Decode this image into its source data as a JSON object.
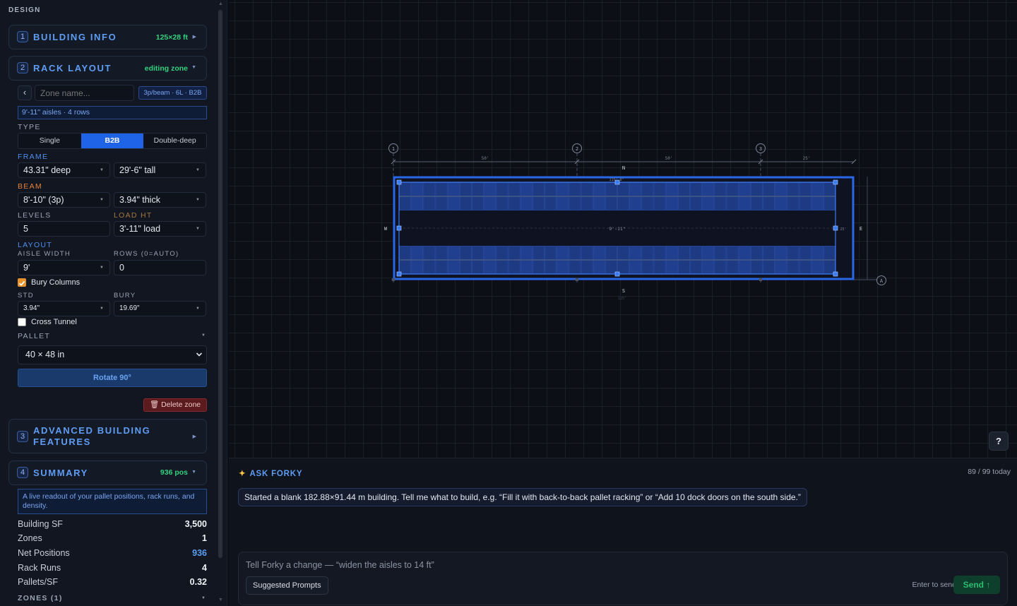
{
  "sidebar": {
    "header": "DESIGN",
    "sections": [
      {
        "num": "1",
        "title": "BUILDING INFO",
        "meta": "125×28 ft"
      },
      {
        "num": "2",
        "title": "RACK LAYOUT",
        "meta": "editing zone"
      },
      {
        "num": "3",
        "title_line1": "ADVANCED BUILDING",
        "title_line2": "FEATURES"
      },
      {
        "num": "4",
        "title": "SUMMARY",
        "meta": "936 pos"
      }
    ],
    "rack": {
      "back": "‹",
      "zone_placeholder": "Zone name...",
      "config_badge": "3p/beam · 6L · B2B",
      "aisle_info": "9'-11\" aisles · 4 rows",
      "type_label": "TYPE",
      "type_options": [
        "Single",
        "B2B",
        "Double-deep"
      ],
      "frame_label": "FRAME",
      "frame_depth": "43.31\" deep",
      "frame_height": "29'-6\" tall",
      "beam_label": "BEAM",
      "beam_length": "8'-10\" (3p)",
      "beam_thick": "3.94\" thick",
      "levels_label": "LEVELS",
      "levels_value": "5",
      "load_ht_label": "LOAD HT",
      "load_ht_value": "3'-11\" load",
      "layout_label": "LAYOUT",
      "aisle_width_label": "AISLE WIDTH",
      "aisle_width_value": "9'",
      "rows_label": "ROWS (0=AUTO)",
      "rows_value": "0",
      "bury_columns": "Bury Columns",
      "std_label": "STD",
      "std_value": "3.94\"",
      "bury_label": "BURY",
      "bury_value": "19.69\"",
      "cross_tunnel": "Cross Tunnel",
      "pallet_label": "PALLET",
      "pallet_value": "40 × 48 in",
      "rotate": "Rotate 90°",
      "delete": "🗑 Delete zone"
    },
    "summary": {
      "blurb": "A live readout of your pallet positions, rack runs, and density.",
      "rows": [
        {
          "label": "Building SF",
          "value": "3,500"
        },
        {
          "label": "Zones",
          "value": "1"
        },
        {
          "label": "Net Positions",
          "value": "936"
        },
        {
          "label": "Rack Runs",
          "value": "4"
        },
        {
          "label": "Pallets/SF",
          "value": "0.32"
        }
      ],
      "zones_label": "ZONES (1)"
    }
  },
  "canvas": {
    "grid_markers": [
      "1",
      "2",
      "3"
    ],
    "corner_marker": "A",
    "dims_top": [
      "50'",
      "50'",
      "25'"
    ],
    "compass": {
      "n": "N",
      "s": "S",
      "w": "W",
      "e": "E"
    },
    "aisle_dim": "9'-11\"",
    "top_dim": "115'-8\"",
    "right_dim": "25'",
    "bottom_dim": "125'",
    "help": "?"
  },
  "chat": {
    "title": "ASK FORKY",
    "usage": "89 / 99 today",
    "message": "Started a blank 182.88×91.44 m building. Tell me what to build, e.g. “Fill it with back-to-back pallet racking” or “Add 10 dock doors on the south side.”",
    "placeholder": "Tell Forky a change — “widen the aisles to 14 ft”",
    "suggested": "Suggested Prompts",
    "enter_hint": "Enter to send",
    "send": "Send ↑"
  },
  "colors": {
    "accent": "#1f63e6",
    "green": "#34d27d",
    "orange": "#e8833a",
    "rack": "#1c3a86"
  }
}
